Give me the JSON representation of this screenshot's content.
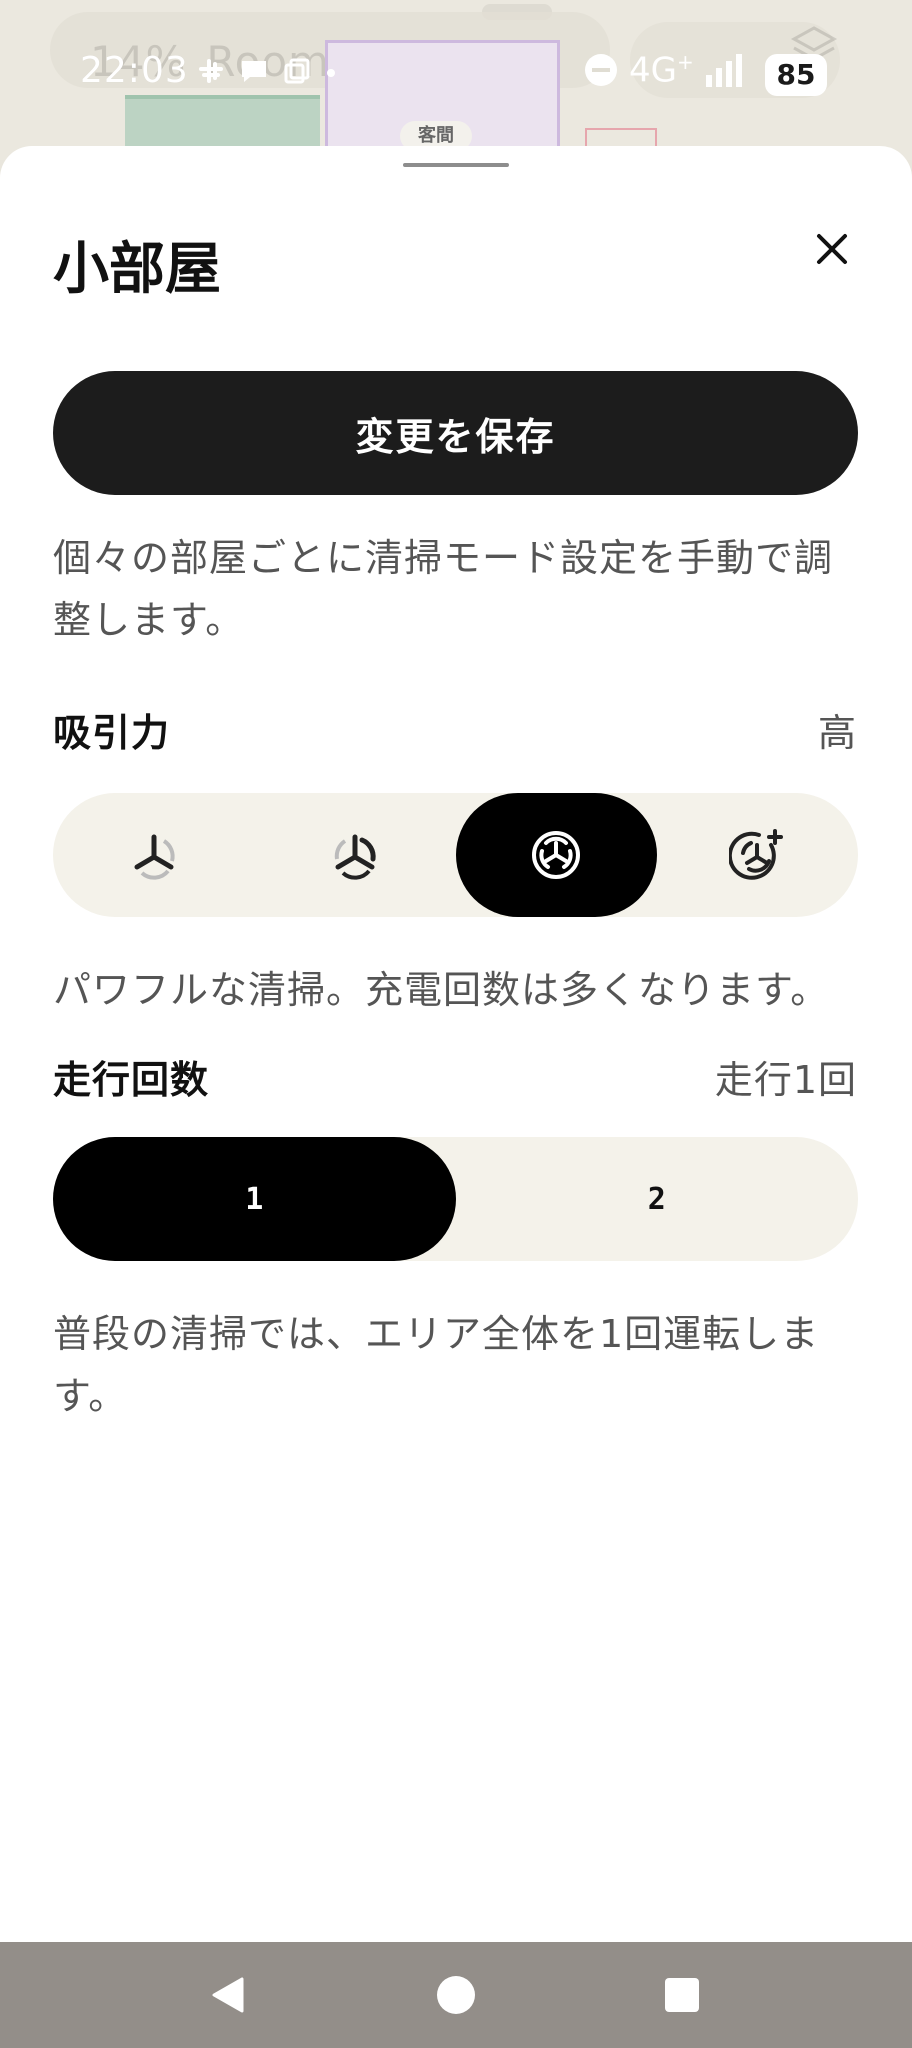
{
  "background_app": {
    "title": "Roombaミニ",
    "battery_text": "14%",
    "room_tag": "客間"
  },
  "status_bar": {
    "time": "22:03",
    "network": "4G",
    "network_sup": "+",
    "battery": "85"
  },
  "sheet": {
    "title": "小部屋",
    "save_label": "変更を保存",
    "description": "個々の部屋ごとに清掃モード設定を手動で調整します。",
    "suction": {
      "label": "吸引力",
      "value": "高",
      "options": [
        {
          "icon": "suction-eco-icon",
          "selected": false
        },
        {
          "icon": "suction-standard-icon",
          "selected": false
        },
        {
          "icon": "suction-high-icon",
          "selected": true
        },
        {
          "icon": "suction-max-icon",
          "selected": false
        }
      ],
      "hint": "パワフルな清掃。充電回数は多くなります。"
    },
    "passes": {
      "label": "走行回数",
      "value": "走行1回",
      "options": [
        "1",
        "2"
      ],
      "selected_index": 0,
      "hint": "普段の清掃では、エリア全体を1回運転します。"
    }
  },
  "colors": {
    "primary": "#1c1c1c",
    "segment_bg": "#f4f2ea",
    "nav_bar": "#938e89"
  }
}
